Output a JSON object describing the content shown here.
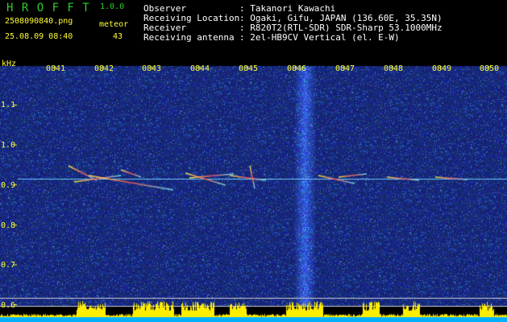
{
  "header": {
    "app_name": "H R O F F T",
    "version": "1.0.0",
    "filename": "2508090840.png",
    "datetime": "25.08.09 08:40",
    "meteor_label": "meteor",
    "meteor_count": "43",
    "info": [
      {
        "label": "Observer",
        "value": ": Takanori Kawachi"
      },
      {
        "label": "Receiving Location",
        "value": ": Ogaki, Gifu, JAPAN (136.60E, 35.35N)"
      },
      {
        "label": "Receiver",
        "value": ": R820T2(RTL-SDR) SDR-Sharp 53.1000MHz"
      },
      {
        "label": "Receiving antenna",
        "value": ": 2el-HB9CV Vertical (el. E-W)"
      }
    ]
  },
  "spectrogram": {
    "unit": "kHz",
    "time_ticks": [
      "0841",
      "0842",
      "0843",
      "0844",
      "0845",
      "0846",
      "0847",
      "0848",
      "0849",
      "0850"
    ],
    "freq_ticks": [
      "1.1",
      "1.0",
      "0.9",
      "0.8",
      "0.7",
      "0.6"
    ],
    "colors": {
      "background": "#0a1070",
      "signal": "#ffff33",
      "level_bar": "#ffee00",
      "baseline": "#00b0ff"
    }
  }
}
